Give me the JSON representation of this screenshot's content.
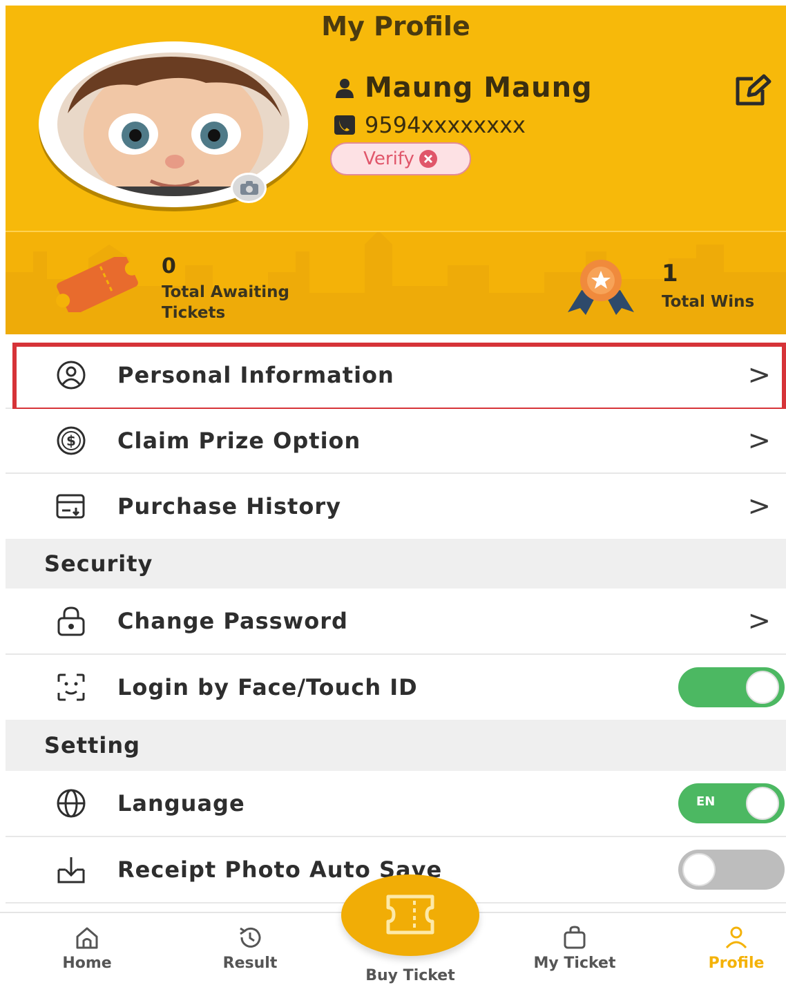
{
  "header": {
    "title": "My Profile",
    "user_name": "Maung Maung",
    "phone": "9594xxxxxxxx",
    "verify_label": "Verify",
    "accent_color": "#f7b90a"
  },
  "stats": {
    "awaiting_count": "0",
    "awaiting_label": "Total Awaiting Tickets",
    "wins_count": "1",
    "wins_label": "Total Wins"
  },
  "menu": {
    "personal_information": "Personal Information",
    "claim_prize_option": "Claim Prize Option",
    "purchase_history": "Purchase History"
  },
  "security": {
    "section_title": "Security",
    "change_password": "Change Password",
    "face_touch_id": "Login by Face/Touch ID",
    "face_touch_id_enabled": true
  },
  "setting": {
    "section_title": "Setting",
    "language": "Language",
    "language_value": "EN",
    "receipt_auto_save": "Receipt Photo Auto Save",
    "receipt_auto_save_enabled": false
  },
  "bottom_nav": {
    "home": "Home",
    "result": "Result",
    "buy_ticket": "Buy Ticket",
    "my_ticket": "My Ticket",
    "profile": "Profile",
    "active": "Profile"
  },
  "icons": {
    "edit": "edit-icon",
    "user": "user-icon",
    "phone": "phone-icon",
    "camera": "camera-icon",
    "ticket": "ticket-icon",
    "medal": "medal-icon",
    "chevron": "chevron-right-icon"
  },
  "chevron_glyph": ">"
}
